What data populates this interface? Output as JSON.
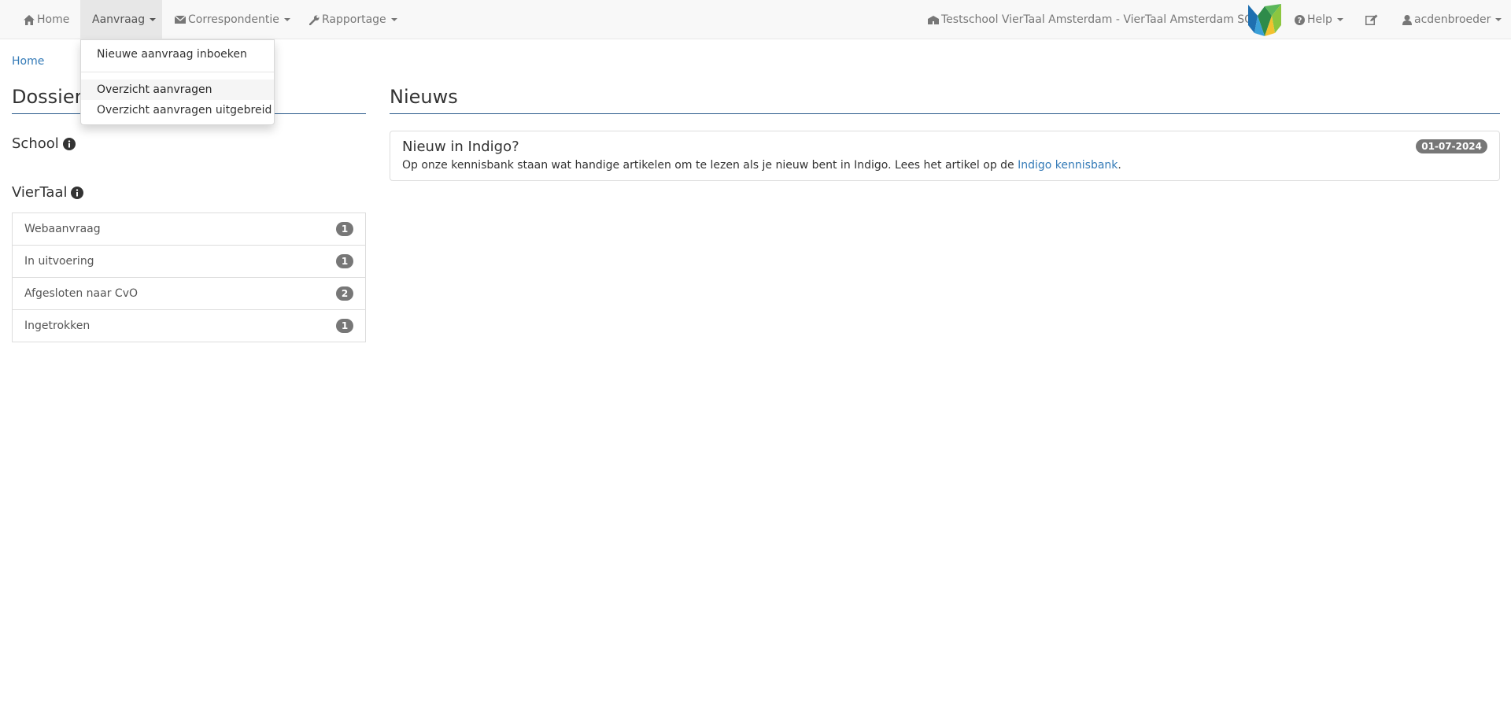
{
  "navbar": {
    "home_label": "Home",
    "aanvraag_label": "Aanvraag",
    "correspondentie_label": "Correspondentie",
    "rapportage_label": "Rapportage",
    "school_label": "Testschool VierTaal Amsterdam - VierTaal Amsterdam SO",
    "help_label": "Help",
    "user_label": "acdenbroeder"
  },
  "aanvraag_menu": {
    "items": [
      {
        "label": "Nieuwe aanvraag inboeken"
      },
      {
        "label": "Overzicht aanvragen"
      },
      {
        "label": "Overzicht aanvragen uitgebreid"
      }
    ]
  },
  "breadcrumb": {
    "home": "Home"
  },
  "dossiers": {
    "title": "Dossiers",
    "school_heading": "School",
    "viertaal_heading": "VierTaal",
    "items": [
      {
        "label": "Webaanvraag",
        "count": "1"
      },
      {
        "label": "In uitvoering",
        "count": "1"
      },
      {
        "label": "Afgesloten naar CvO",
        "count": "2"
      },
      {
        "label": "Ingetrokken",
        "count": "1"
      }
    ]
  },
  "news": {
    "title": "Nieuws",
    "items": [
      {
        "title": "Nieuw in Indigo?",
        "date": "01-07-2024",
        "text_before": "Op onze kennisbank staan wat handige artikelen om te lezen als je nieuw bent in Indigo. Lees het artikel op de ",
        "link_text": "Indigo kennisbank",
        "text_after": "."
      }
    ]
  },
  "icons": {
    "home": "home-icon",
    "envelope": "envelope-icon",
    "wrench": "wrench-icon",
    "school": "school-icon",
    "help": "question-circle-icon",
    "edit": "edit-icon",
    "user": "user-icon",
    "info": "info-circle-icon"
  },
  "colors": {
    "link": "#337ab7",
    "badge": "#777777",
    "navbar_bg": "#f8f8f8",
    "heading_rule": "#2a5a8c"
  }
}
